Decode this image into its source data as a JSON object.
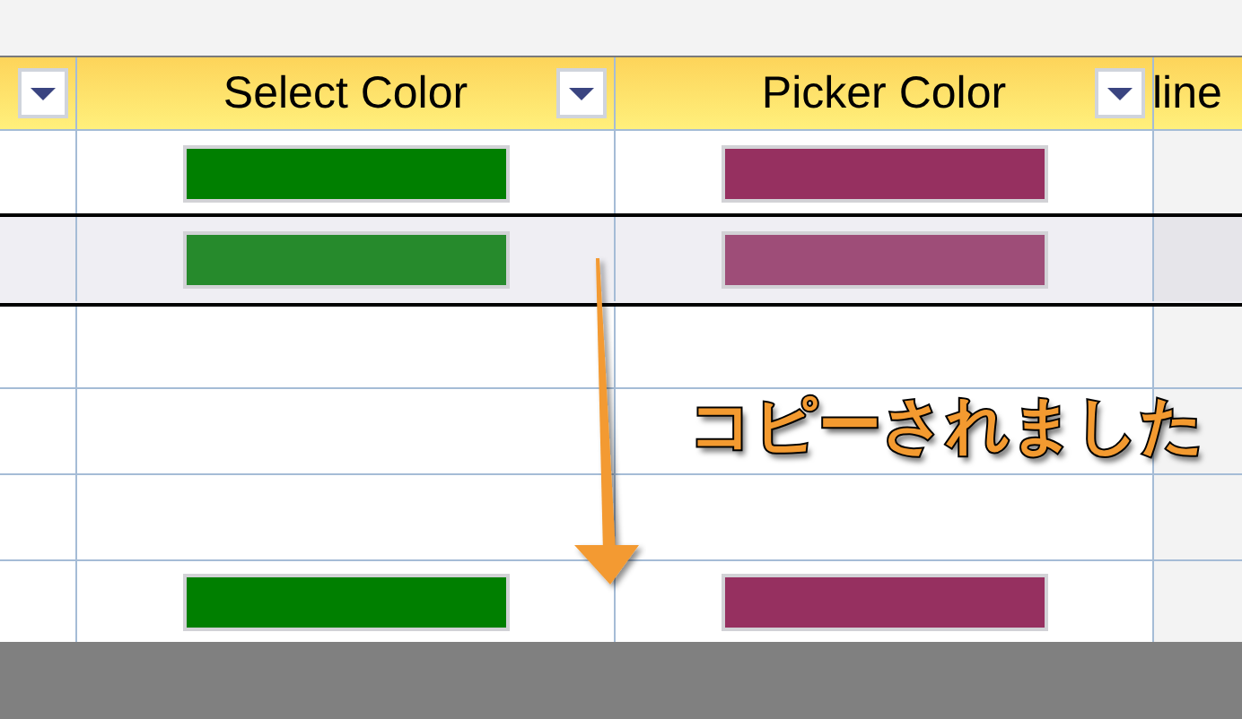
{
  "columns": [
    {
      "filter_button": true
    },
    {
      "label": "Select Color",
      "filter_button": true
    },
    {
      "label": "Picker Color",
      "filter_button": true
    },
    {
      "label": "line",
      "filter_button": false
    }
  ],
  "rows": [
    {
      "selected": false,
      "cells": [
        {
          "color": "#007f00"
        },
        {
          "color": "#963060"
        }
      ]
    },
    {
      "selected": true,
      "cells": [
        {
          "color": "#268a2c"
        },
        {
          "color": "#9e4d78"
        }
      ]
    },
    {
      "selected": false
    },
    {
      "selected": false
    },
    {
      "selected": false
    },
    {
      "selected": false,
      "cells": [
        {
          "color": "#007f00"
        },
        {
          "color": "#963060"
        }
      ]
    }
  ],
  "toast": {
    "text": "コピーされました"
  }
}
